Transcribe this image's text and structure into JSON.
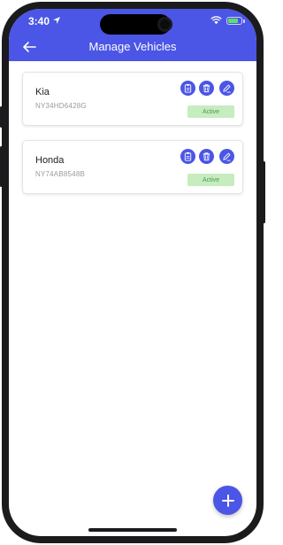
{
  "status_bar": {
    "time": "3:40",
    "icons": [
      "location-icon",
      "wifi-icon",
      "battery-charging-icon"
    ]
  },
  "header": {
    "title": "Manage Vehicles",
    "back_icon": "arrow-left-icon"
  },
  "vehicles": [
    {
      "name": "Kia",
      "plate": "NY34HD6428G",
      "status": "Active"
    },
    {
      "name": "Honda",
      "plate": "NY74AB8548B",
      "status": "Active"
    }
  ],
  "card_actions": [
    "clipboard-icon",
    "trash-icon",
    "pencil-icon"
  ],
  "fab": {
    "icon": "plus-icon"
  },
  "colors": {
    "brand": "#4b55e6",
    "status_bg": "#c6ecc0",
    "status_text": "#4c9a48",
    "battery": "#5ee06a"
  }
}
